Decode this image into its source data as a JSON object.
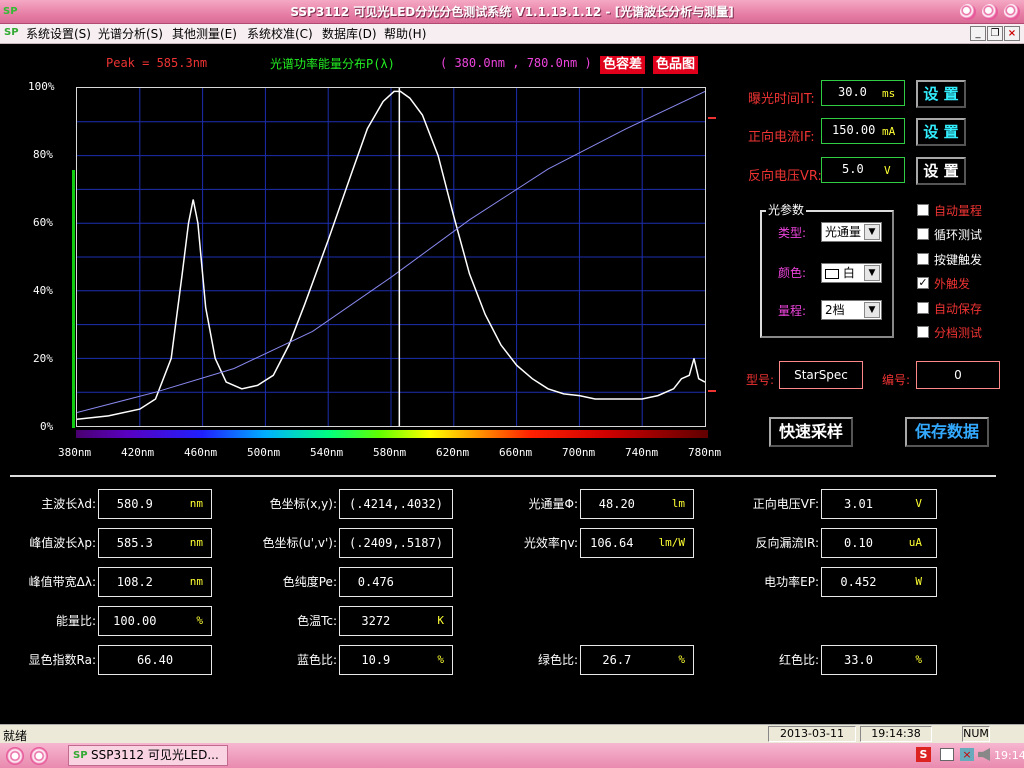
{
  "window": {
    "title": "SSP3112 可见光LED分光分色测试系统 V1.1.13.1.12 - [光谱波长分析与测量]"
  },
  "menu": [
    "系统设置(S)",
    "光谱分析(S)",
    "其他测量(E)",
    "系统校准(C)",
    "数据库(D)",
    "帮助(H)"
  ],
  "mdi_buttons": [
    "_",
    "❐",
    "×"
  ],
  "header": {
    "peak": "Peak = 585.3nm",
    "title": "光谱功率能量分布P(λ)",
    "range": "( 380.0nm , 780.0nm )",
    "btn_color_diff": "色容差",
    "btn_chroma": "色品图"
  },
  "chart_data": {
    "type": "line",
    "xlabel": "",
    "ylabel": "",
    "xlim": [
      380,
      780
    ],
    "ylim": [
      0,
      100
    ],
    "x_ticks": [
      "380nm",
      "420nm",
      "460nm",
      "500nm",
      "540nm",
      "580nm",
      "620nm",
      "660nm",
      "700nm",
      "740nm",
      "780nm"
    ],
    "y_ticks": [
      "0%",
      "20%",
      "40%",
      "60%",
      "80%",
      "100%"
    ],
    "marker_x": 585.3,
    "grid": true,
    "series": [
      {
        "color": "#ffffff",
        "points": [
          [
            380,
            2
          ],
          [
            400,
            3
          ],
          [
            420,
            5
          ],
          [
            430,
            8
          ],
          [
            440,
            20
          ],
          [
            447,
            45
          ],
          [
            451,
            60
          ],
          [
            454,
            67
          ],
          [
            457,
            60
          ],
          [
            462,
            35
          ],
          [
            468,
            20
          ],
          [
            475,
            13
          ],
          [
            485,
            11
          ],
          [
            495,
            12
          ],
          [
            505,
            15
          ],
          [
            515,
            24
          ],
          [
            525,
            36
          ],
          [
            540,
            55
          ],
          [
            555,
            75
          ],
          [
            565,
            88
          ],
          [
            575,
            96
          ],
          [
            582,
            99
          ],
          [
            586,
            99
          ],
          [
            592,
            97
          ],
          [
            600,
            92
          ],
          [
            610,
            80
          ],
          [
            620,
            62
          ],
          [
            630,
            45
          ],
          [
            640,
            33
          ],
          [
            650,
            24
          ],
          [
            660,
            18
          ],
          [
            670,
            14
          ],
          [
            680,
            11
          ],
          [
            690,
            9.5
          ],
          [
            700,
            9
          ],
          [
            710,
            8
          ],
          [
            720,
            8
          ],
          [
            730,
            8
          ],
          [
            740,
            8
          ],
          [
            750,
            9
          ],
          [
            760,
            11
          ],
          [
            765,
            14
          ],
          [
            770,
            15
          ],
          [
            773,
            20
          ],
          [
            776,
            14
          ],
          [
            780,
            13
          ]
        ]
      },
      {
        "color": "#8888ee",
        "points": [
          [
            380,
            4
          ],
          [
            430,
            10
          ],
          [
            480,
            17
          ],
          [
            530,
            28
          ],
          [
            580,
            44
          ],
          [
            630,
            61
          ],
          [
            680,
            76
          ],
          [
            730,
            88
          ],
          [
            780,
            99
          ]
        ]
      }
    ]
  },
  "controls": {
    "exposure": {
      "label": "曝光时间IT:",
      "value": "30.0",
      "unit": "ms",
      "btn": "设 置"
    },
    "current": {
      "label": "正向电流IF:",
      "value": "150.00",
      "unit": "mA",
      "btn": "设 置"
    },
    "voltage": {
      "label": "反向电压VR:",
      "value": "5.0",
      "unit": "V",
      "btn": "设 置"
    }
  },
  "light_params": {
    "legend": "光参数",
    "type_label": "类型:",
    "type_value": "光通量",
    "color_label": "颜色:",
    "color_value": "白",
    "range_label": "量程:",
    "range_value": "2档"
  },
  "checkboxes": [
    {
      "label": "自动量程",
      "checked": false
    },
    {
      "label": "循环测试",
      "checked": false
    },
    {
      "label": "按键触发",
      "checked": false
    },
    {
      "label": "外触发",
      "checked": true
    },
    {
      "label": "自动保存",
      "checked": false
    },
    {
      "label": "分档测试",
      "checked": false
    }
  ],
  "model": {
    "label": "型号:",
    "value": "StarSpec"
  },
  "serial": {
    "label": "编号:",
    "value": "0"
  },
  "actions": {
    "quick_sample": "快速采样",
    "save_data": "保存数据"
  },
  "results": {
    "dominant_wl": {
      "label": "主波长λd:",
      "value": "580.9",
      "unit": "nm"
    },
    "peak_wl": {
      "label": "峰值波长λp:",
      "value": "585.3",
      "unit": "nm"
    },
    "fwhm": {
      "label": "峰值带宽Δλ:",
      "value": "108.2",
      "unit": "nm"
    },
    "energy_ratio": {
      "label": "能量比:",
      "value": "100.00",
      "unit": "%"
    },
    "cri": {
      "label": "显色指数Ra:",
      "value": "66.40",
      "unit": ""
    },
    "xy": {
      "label": "色坐标(x,y):",
      "value": "(.4214,.4032)",
      "unit": ""
    },
    "uv": {
      "label": "色坐标(u',v'):",
      "value": "(.2409,.5187)",
      "unit": ""
    },
    "purity": {
      "label": "色纯度Pe:",
      "value": "0.476",
      "unit": ""
    },
    "cct": {
      "label": "色温Tc:",
      "value": "3272",
      "unit": "K"
    },
    "blue_ratio": {
      "label": "蓝色比:",
      "value": "10.9",
      "unit": "%"
    },
    "flux": {
      "label": "光通量Φ:",
      "value": "48.20",
      "unit": "lm"
    },
    "efficacy": {
      "label": "光效率ηv:",
      "value": "106.64",
      "unit": "lm/W"
    },
    "green_ratio": {
      "label": "绿色比:",
      "value": "26.7",
      "unit": "%"
    },
    "vf": {
      "label": "正向电压VF:",
      "value": "3.01",
      "unit": "V"
    },
    "ir": {
      "label": "反向漏流IR:",
      "value": "0.10",
      "unit": "uA"
    },
    "power": {
      "label": "电功率EP:",
      "value": "0.452",
      "unit": "W"
    },
    "red_ratio": {
      "label": "红色比:",
      "value": "33.0",
      "unit": "%"
    }
  },
  "status": {
    "text": "就绪",
    "date": "2013-03-11",
    "time": "19:14:38",
    "num": "NUM"
  },
  "taskbar": {
    "app": "SSP3112 可见光LED...",
    "clock": "19:14"
  }
}
